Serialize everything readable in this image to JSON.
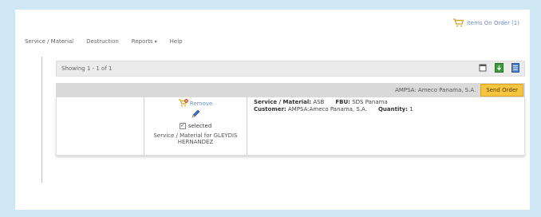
{
  "header": {
    "order_link": "Items On Order (1)"
  },
  "menu": {
    "items": [
      "Service / Material",
      "Destruction",
      "Reports",
      "Help"
    ]
  },
  "results": {
    "showing": "Showing 1 - 1 of 1"
  },
  "order": {
    "customer_header": "AMPSA: Ameco Panama, S.A.",
    "send_button": "Send Order",
    "remove_label": "Remove",
    "selected_label": "selected",
    "service_for": "Service / Material for GLEYDIS HERNANDEZ",
    "service_material_label": "Service / Material:",
    "service_material_value": "ASB",
    "fbu_label": "FBU:",
    "fbu_value": "SDS Panama",
    "customer_label": "Customer:",
    "customer_value": "AMPSA:Ameco Panama, S.A.",
    "quantity_label": "Quantity:",
    "quantity_value": "1"
  },
  "icons": [
    "cart-icon",
    "caret-down-icon",
    "window-icon",
    "excel-export-icon",
    "document-icon",
    "remove-icon",
    "edit-pencil-icon",
    "checkbox-icon"
  ],
  "colors": {
    "background": "#cfe6f4",
    "send_button": "#f5c542",
    "link": "#6a8fc0",
    "toolbar": "#ebebeb"
  }
}
